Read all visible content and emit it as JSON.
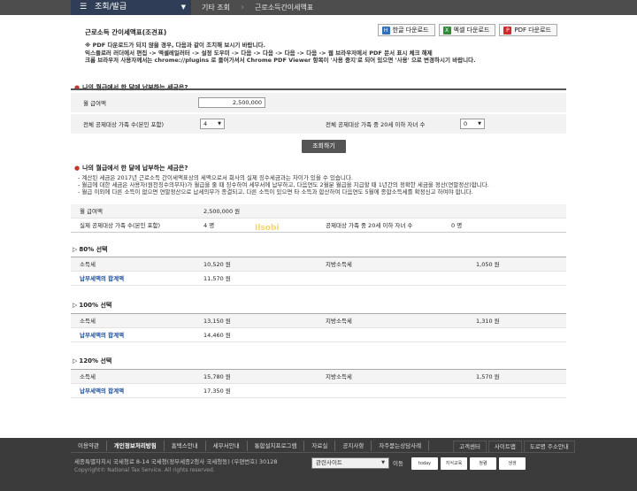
{
  "nav": {
    "main": "조회/발급",
    "crumb1": "기타 조회",
    "crumb2": "근로소득간이세액표"
  },
  "doc": {
    "title": "근로소득 간이세액표(조견표)",
    "buttons": [
      "한글 다운로드",
      "엑셀 다운로드",
      "PDF 다운로드"
    ],
    "notice": [
      "※ PDF 다운로드가 되지 않을 경우, 다음과 같이 조치해 보시기 바랍니다.",
      "익스플로러 러더에서 편집 -> 엑셀레일러터 -> 설정 도우미 -> 다음 -> 다음 -> 다음 -> 다음 -> 웹 브라우저에서 PDF 문서 표시 체크 해제",
      "크롬 브라우저 사용자께서는 chrome://plugins 로 들어가셔서 Chrome PDF Viewer 항목이 '사용 중지'로 되어 있으면 '사용' 으로 변경하시기 바랍니다."
    ]
  },
  "form": {
    "section_title": "나의 월급에서 한 달에 납부하는 세금은?",
    "salary_label": "월 급여액",
    "salary_value": "2,500,000",
    "family_label": "전체 공제대상 가족 수(본인 포함)",
    "family_value": "4",
    "children_label": "전체 공제대상 가족 중 20세 이하 자녀 수",
    "children_value": "0",
    "calc_button": "조회하기"
  },
  "result": {
    "section_title": "나의 월급에서 한 달에 납부하는 세금은?",
    "explain": [
      "- 계산된 세금은 2017년 근로소득 간이세액표상의 세액으로서 회사의 실제 징수세금과는 차이가 있을 수 있습니다.",
      "- 월급에 대한 세금은 사용자(원천징수의무자)가 월급을 줄 때 징수하여 세무서에 납부하고, 다음연도 2월분 월급을 지급할 때 1년간의 정확한 세금을 정산(연말정산)합니다.",
      "- 월급 이외에 다른 소득이 없으면 연말정산으로 납세의무가 종결되고, 다른 소득이 있으면 타 소득과 합산하여 다음연도 5월에 종합소득세를 확정신고 하여야 합니다."
    ],
    "salary_label": "월 급여액",
    "salary_value": "2,500,000 원",
    "family_label": "실제 공제대상 가족 수(본인 포함)",
    "family_value": "4 명",
    "children_label": "공제대상 가족 중 20세 이하 자녀 수",
    "children_value": "0 명",
    "groups": [
      {
        "title": "80% 선택",
        "income_tax_label": "소득세",
        "income_tax": "10,520 원",
        "local_tax_label": "지방소득세",
        "local_tax": "1,050 원",
        "total_label": "납부세액의 합계액",
        "total": "11,570 원"
      },
      {
        "title": "100% 선택",
        "income_tax_label": "소득세",
        "income_tax": "13,150 원",
        "local_tax_label": "지방소득세",
        "local_tax": "1,310 원",
        "total_label": "납부세액의 합계액",
        "total": "14,460 원"
      },
      {
        "title": "120% 선택",
        "income_tax_label": "소득세",
        "income_tax": "15,780 원",
        "local_tax_label": "지방소득세",
        "local_tax": "1,570 원",
        "total_label": "납부세액의 합계액",
        "total": "17,350 원"
      }
    ]
  },
  "footer": {
    "links": [
      "이용약관",
      "개인정보처리방침",
      "홈택스안내",
      "세무서안내",
      "통합설치프로그램",
      "자료실",
      "공지사항",
      "자주묻는상담사례"
    ],
    "links2": [
      "고객센터",
      "사이트맵",
      "도로명 주소안내"
    ],
    "address": "세종특별자치시 국세청로 8-14 국세청(정부세종2청사 국세청동) (우편번호) 30128",
    "copyright": "Copyright© National Tax Service. All rights reserved.",
    "related_site": "관련사이트",
    "go": "이동",
    "banners": [
      "today",
      "지식교육",
      "청렴",
      "생생"
    ]
  },
  "watermark": "Ilsobi"
}
